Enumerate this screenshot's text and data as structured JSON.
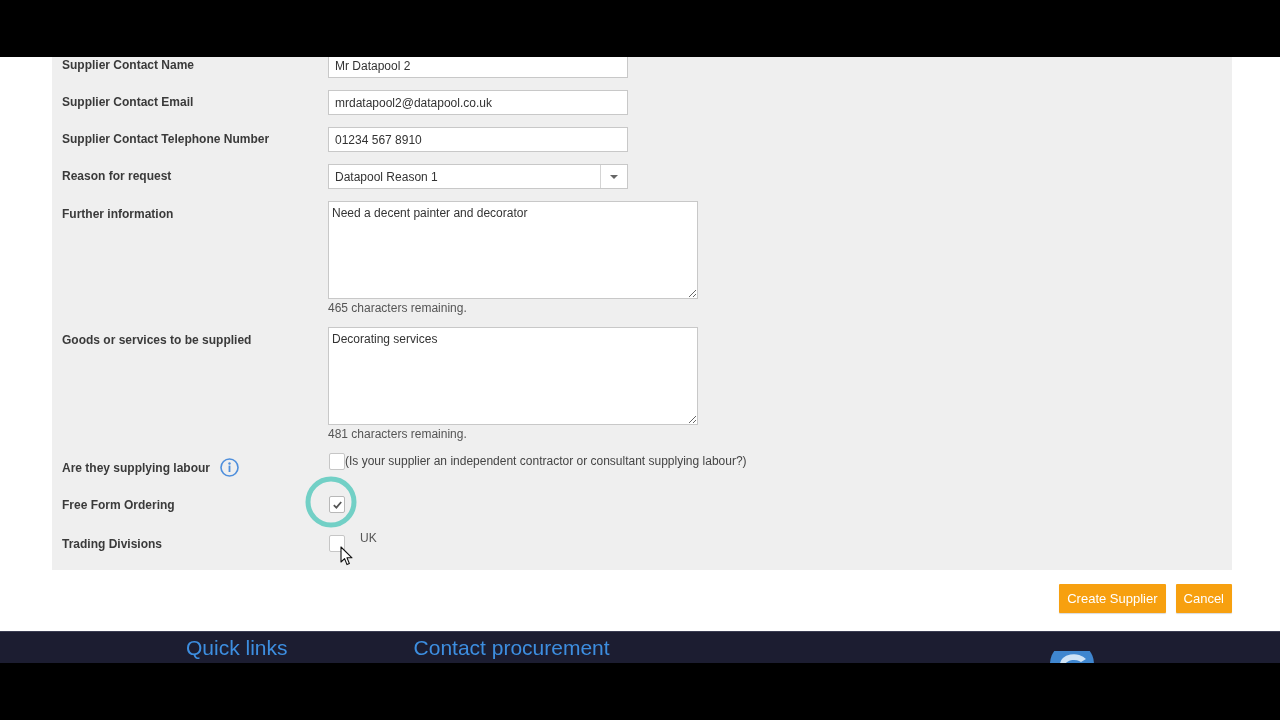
{
  "fields": [
    {
      "kind": "text",
      "label": "Supplier Contact Name",
      "value": "Mr Datapool 2"
    },
    {
      "kind": "text",
      "label": "Supplier Contact Email",
      "value": "mrdatapool2@datapool.co.uk"
    },
    {
      "kind": "text",
      "label": "Supplier Contact Telephone Number",
      "value": "01234 567 8910"
    },
    {
      "kind": "select",
      "label": "Reason for request",
      "value": "Datapool Reason 1"
    },
    {
      "kind": "textarea",
      "label": "Further information",
      "value": "Need a decent painter and decorator",
      "counter": "465 characters remaining."
    },
    {
      "kind": "textarea",
      "label": "Goods or services to be supplied",
      "value": "Decorating services",
      "counter": "481 characters remaining."
    },
    {
      "kind": "checkbox",
      "label": "Are they supplying labour",
      "info": true,
      "checked": false,
      "caption": "(Is your supplier an independent contractor or consultant supplying labour?)"
    },
    {
      "kind": "checkbox",
      "label": "Free Form Ordering",
      "checked": true,
      "click_highlight": true
    },
    {
      "kind": "checkbox",
      "label": "Trading Divisions",
      "checked": false,
      "option": "UK",
      "pointer": true
    }
  ],
  "buttons": [
    {
      "label": "Create Supplier"
    },
    {
      "label": "Cancel"
    }
  ],
  "footer": {
    "links": [
      "Quick links",
      "Contact procurement"
    ]
  }
}
